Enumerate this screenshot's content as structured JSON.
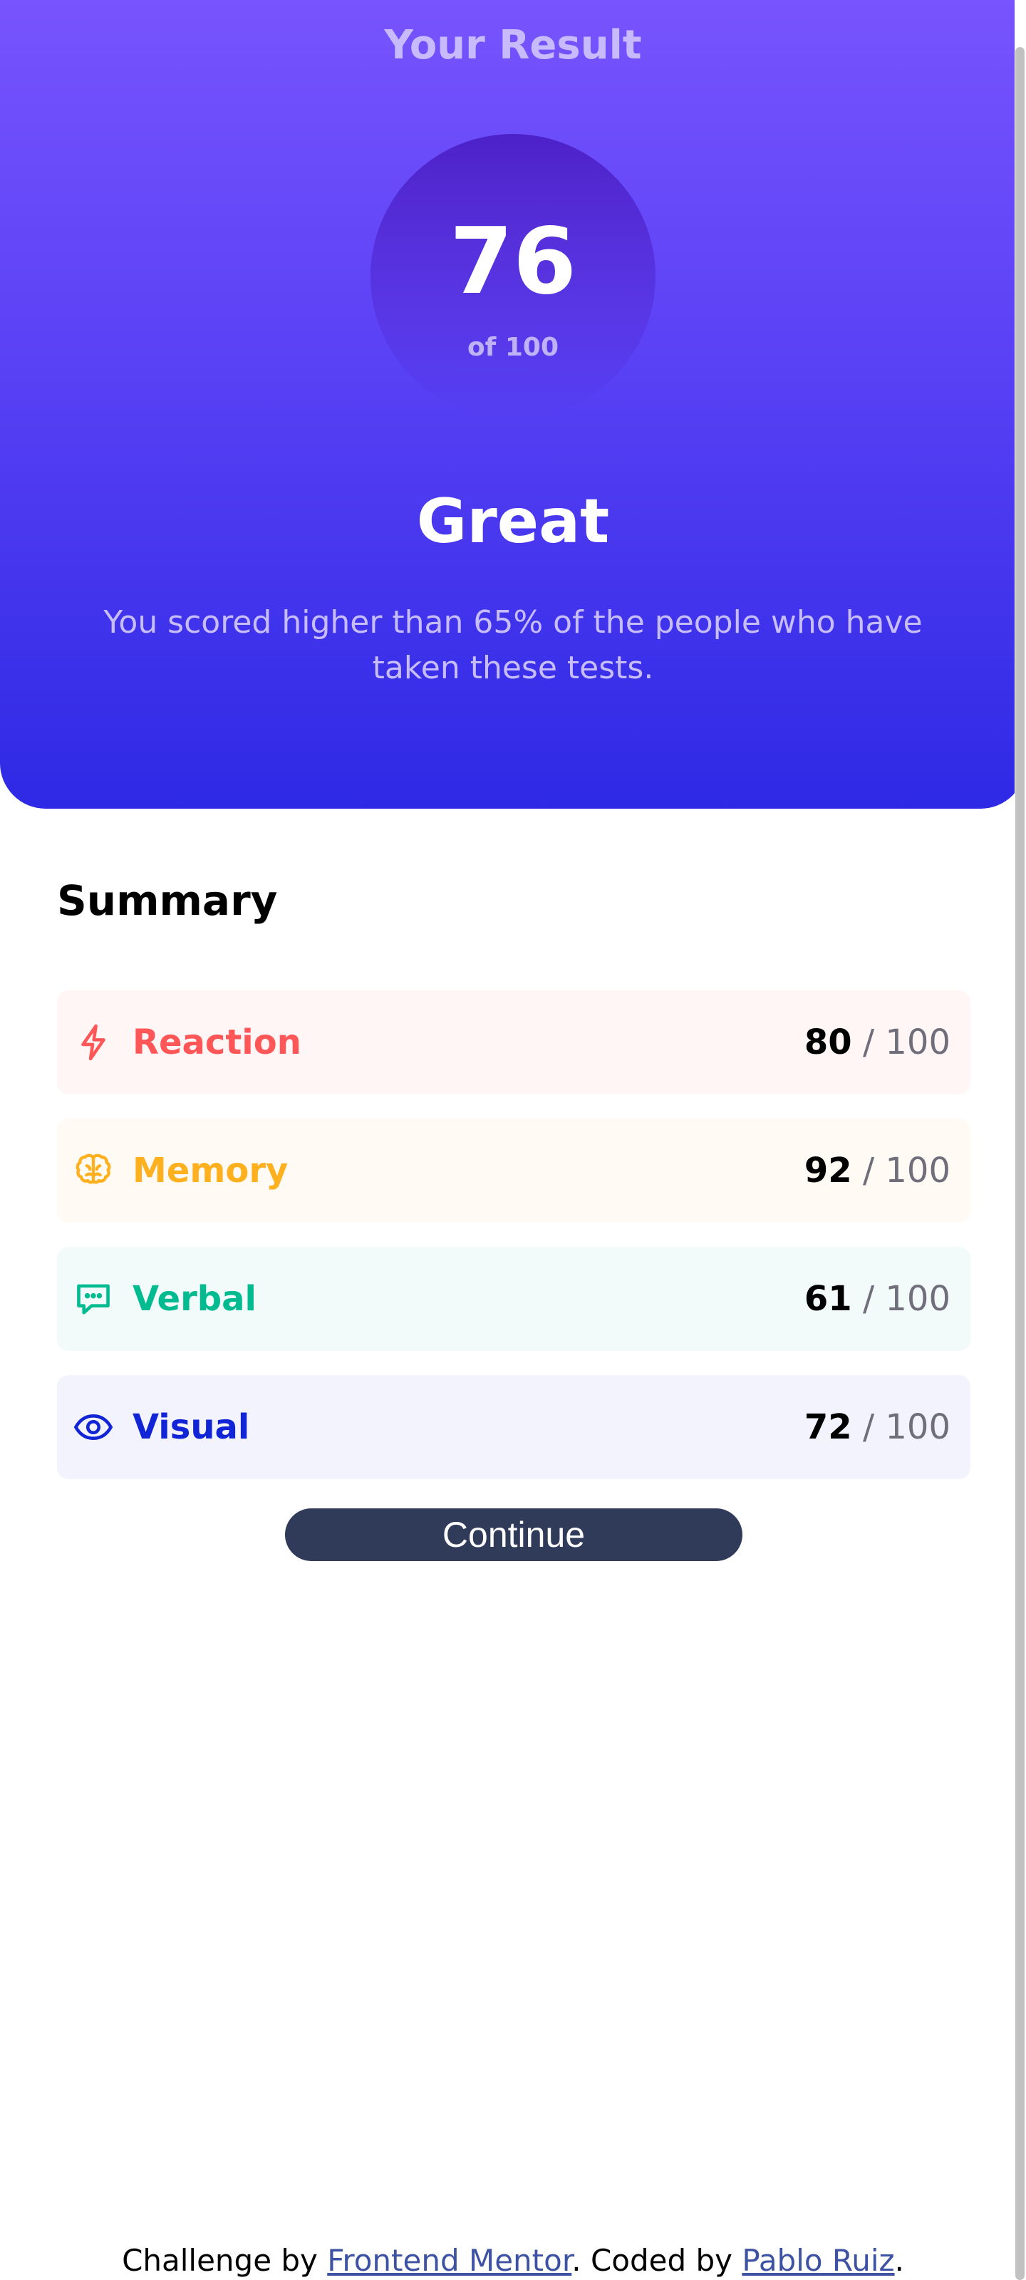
{
  "result": {
    "title": "Your Result",
    "score": "76",
    "score_max": "of 100",
    "verdict": "Great",
    "description": "You scored higher than 65% of the people who have taken these tests."
  },
  "summary": {
    "title": "Summary",
    "items": [
      {
        "label": "Reaction",
        "score": "80",
        "max": "/ 100",
        "icon": "lightning-icon",
        "color": "#ff5757",
        "background": "#fff6f5"
      },
      {
        "label": "Memory",
        "score": "92",
        "max": "/ 100",
        "icon": "brain-icon",
        "color": "#ffb01f",
        "background": "#fffbf4"
      },
      {
        "label": "Verbal",
        "score": "61",
        "max": "/ 100",
        "icon": "chat-bubble-icon",
        "color": "#00bb8f",
        "background": "#f2fbfa"
      },
      {
        "label": "Visual",
        "score": "72",
        "max": "/ 100",
        "icon": "eye-icon",
        "color": "#1125d6",
        "background": "#f3f3fd"
      }
    ],
    "continue_label": "Continue"
  },
  "footer": {
    "prefix": "Challenge by",
    "link1": "Frontend Mentor",
    "middle": ". Coded by",
    "link2": "Pablo Ruiz",
    "suffix": "."
  },
  "colors": {
    "hero_gradient_top": "#7754fd",
    "hero_gradient_bottom": "#2e29e5",
    "button": "#303b59"
  }
}
